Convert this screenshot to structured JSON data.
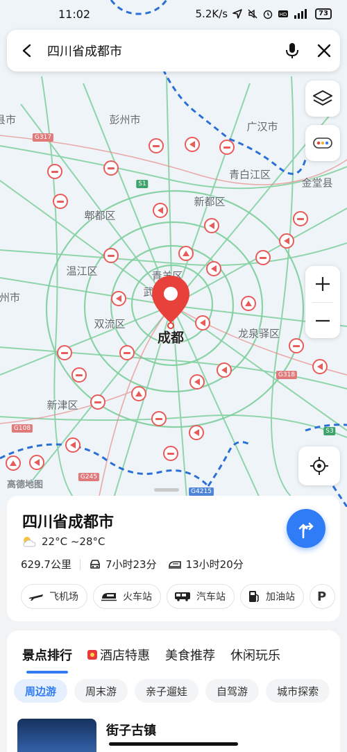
{
  "status_bar": {
    "time": "11:02",
    "speed": "5.2K/s",
    "battery": "73"
  },
  "search": {
    "query": "四川省成都市"
  },
  "map": {
    "main_city": "成都",
    "watermark": "高德地图",
    "places": [
      {
        "label": "彭州市"
      },
      {
        "label": "广汉市"
      },
      {
        "label": "青白江区"
      },
      {
        "label": "金堂县"
      },
      {
        "label": "郫都区"
      },
      {
        "label": "新都区"
      },
      {
        "label": "温江区"
      },
      {
        "label": "青羊区"
      },
      {
        "label": "武"
      },
      {
        "label": "州市"
      },
      {
        "label": "双流区"
      },
      {
        "label": "龙泉驿区"
      },
      {
        "label": "新津区"
      },
      {
        "label": "县市"
      }
    ],
    "road_badges": [
      "G317",
      "S1",
      "G318",
      "S3",
      "G108",
      "G245",
      "G4215"
    ]
  },
  "place_card": {
    "title": "四川省成都市",
    "weather": "22°C ~28°C",
    "distance": "629.7公里",
    "drive_time": "7小时23分",
    "train_time": "13小时20分",
    "chips": [
      {
        "label": "飞机场",
        "icon": "plane-icon"
      },
      {
        "label": "火车站",
        "icon": "train-icon"
      },
      {
        "label": "汽车站",
        "icon": "bus-icon"
      },
      {
        "label": "加油站",
        "icon": "gas-icon"
      },
      {
        "label": "P",
        "icon": "parking-icon"
      }
    ]
  },
  "explore": {
    "tabs": [
      "景点排行",
      "酒店特惠",
      "美食推荐",
      "休闲玩乐"
    ],
    "subtabs": [
      "周边游",
      "周末游",
      "亲子遛娃",
      "自驾游",
      "城市探索"
    ],
    "first_item": "街子古镇"
  },
  "colors": {
    "accent": "#2f7cf6",
    "marker": "#e8403a",
    "roads": "#6cc58d",
    "boundary": "#2a6fd6"
  }
}
